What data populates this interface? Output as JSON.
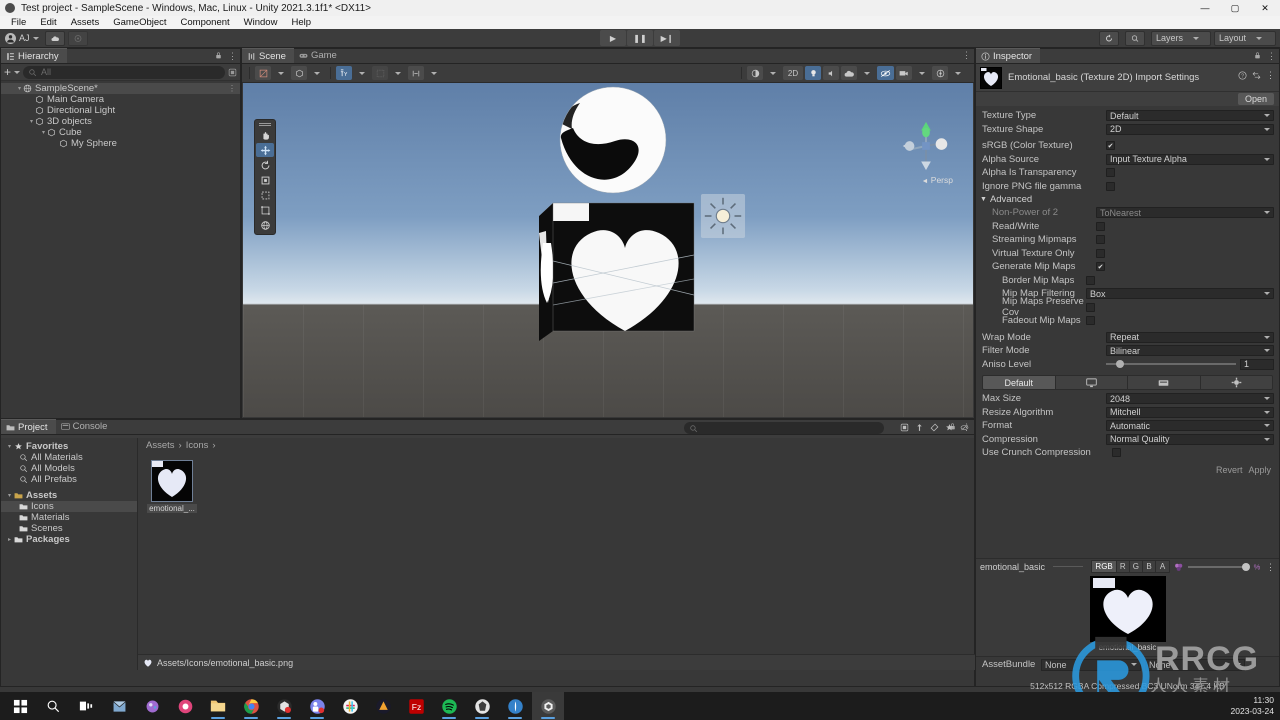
{
  "window": {
    "title": "Test project - SampleScene - Windows, Mac, Linux - Unity 2021.3.1f1* <DX11>",
    "minimize": "—",
    "maximize": "▢",
    "close": "✕"
  },
  "menubar": {
    "items": [
      "File",
      "Edit",
      "Assets",
      "GameObject",
      "Component",
      "Window",
      "Help"
    ]
  },
  "toolbar": {
    "account": "AJ",
    "cloud_icon": "cloud-icon",
    "services_icon": "services-icon",
    "play": "▶",
    "pause": "❚❚",
    "step": "▶❙",
    "undo_history_icon": "undo-history-icon",
    "search_icon": "search-icon",
    "layers": "Layers",
    "layout": "Layout"
  },
  "hierarchy": {
    "tab": "Hierarchy",
    "add_button": "+",
    "search_placeholder": "All",
    "rows": [
      {
        "label": "SampleScene*",
        "depth": 0,
        "arrow": "▾",
        "icon": "scene-icon",
        "selected": true
      },
      {
        "label": "Main Camera",
        "depth": 1,
        "arrow": "",
        "icon": "gameobject-icon",
        "selected": false
      },
      {
        "label": "Directional Light",
        "depth": 1,
        "arrow": "",
        "icon": "gameobject-icon",
        "selected": false
      },
      {
        "label": "3D objects",
        "depth": 1,
        "arrow": "▾",
        "icon": "gameobject-icon",
        "selected": false
      },
      {
        "label": "Cube",
        "depth": 2,
        "arrow": "▾",
        "icon": "gameobject-icon",
        "selected": false
      },
      {
        "label": "My Sphere",
        "depth": 3,
        "arrow": "",
        "icon": "gameobject-icon",
        "selected": false
      }
    ]
  },
  "scene": {
    "tabs": [
      {
        "label": "Scene",
        "active": true,
        "icon": "scene-view-icon"
      },
      {
        "label": "Game",
        "active": false,
        "icon": "game-view-icon"
      }
    ],
    "left_tools": [
      {
        "name": "shading-mode-dropdown",
        "glyph": "◧"
      },
      {
        "name": "draw-mode-dropdown",
        "glyph": "◈"
      },
      {
        "name": "2d-toggle-y",
        "glyph": "Y"
      },
      {
        "name": "grid-snap-dropdown",
        "glyph": "▦"
      },
      {
        "name": "component-tools",
        "glyph": "✛"
      }
    ],
    "right_tools": [
      {
        "name": "fx-toggle",
        "glyph": "◐",
        "on": false
      },
      {
        "name": "2d-button",
        "glyph": "2D",
        "on": false
      },
      {
        "name": "lighting-toggle",
        "glyph": "💡",
        "on": true
      },
      {
        "name": "audio-toggle",
        "glyph": "🔈",
        "on": false
      },
      {
        "name": "effects-toggle",
        "glyph": "☁",
        "on": false
      },
      {
        "name": "hidden-objects-toggle",
        "glyph": "👁",
        "on": true
      },
      {
        "name": "camera-settings",
        "glyph": "📷",
        "on": false
      },
      {
        "name": "gizmos-toggle",
        "glyph": "◉",
        "on": false
      }
    ],
    "gizmo_tools": [
      {
        "name": "hand-tool",
        "glyph": "✋",
        "on": false
      },
      {
        "name": "move-tool",
        "glyph": "✥",
        "on": true
      },
      {
        "name": "rotate-tool",
        "glyph": "⟳",
        "on": false
      },
      {
        "name": "scale-tool",
        "glyph": "⤢",
        "on": false
      },
      {
        "name": "rect-tool",
        "glyph": "⬚",
        "on": false
      },
      {
        "name": "transform-tool",
        "glyph": "✤",
        "on": false
      },
      {
        "name": "custom-editor-tool",
        "glyph": "⊕",
        "on": false
      }
    ],
    "persp_label": "Persp"
  },
  "project": {
    "tabs": [
      {
        "label": "Project",
        "active": true,
        "icon": "project-icon"
      },
      {
        "label": "Console",
        "active": false,
        "icon": "console-icon"
      }
    ],
    "add_button": "+",
    "search_placeholder": "",
    "tree": [
      {
        "label": "Favorites",
        "depth": 0,
        "arrow": "▾",
        "icon": "star-icon",
        "selected": false
      },
      {
        "label": "All Materials",
        "depth": 1,
        "arrow": "",
        "icon": "search-icon",
        "selected": false
      },
      {
        "label": "All Models",
        "depth": 1,
        "arrow": "",
        "icon": "search-icon",
        "selected": false
      },
      {
        "label": "All Prefabs",
        "depth": 1,
        "arrow": "",
        "icon": "search-icon",
        "selected": false
      },
      {
        "label": "Assets",
        "depth": 0,
        "arrow": "▾",
        "icon": "folder-icon",
        "selected": false
      },
      {
        "label": "Icons",
        "depth": 1,
        "arrow": "",
        "icon": "folder-icon",
        "selected": true
      },
      {
        "label": "Materials",
        "depth": 1,
        "arrow": "",
        "icon": "folder-icon",
        "selected": false
      },
      {
        "label": "Scenes",
        "depth": 1,
        "arrow": "",
        "icon": "folder-icon",
        "selected": false
      },
      {
        "label": "Packages",
        "depth": 0,
        "arrow": "▸",
        "icon": "folder-icon",
        "selected": false
      }
    ],
    "breadcrumb": [
      "Assets",
      "Icons"
    ],
    "assets": [
      {
        "label": "emotional_...",
        "icon": "heart-texture-thumbnail",
        "selected": true
      }
    ],
    "status_path": "Assets/Icons/emotional_basic.png"
  },
  "inspector": {
    "tab": "Inspector",
    "header_title": "Emotional_basic (Texture 2D) Import Settings",
    "open_label": "Open",
    "fields": [
      {
        "label": "Texture Type",
        "type": "dropdown",
        "value": "Default",
        "dim": false,
        "indent": 0
      },
      {
        "label": "Texture Shape",
        "type": "dropdown",
        "value": "2D",
        "dim": false,
        "indent": 0
      },
      {
        "label": "sRGB (Color Texture)",
        "type": "checkbox",
        "value": true,
        "dim": false,
        "indent": 0
      },
      {
        "label": "Alpha Source",
        "type": "dropdown",
        "value": "Input Texture Alpha",
        "dim": false,
        "indent": 0
      },
      {
        "label": "Alpha Is Transparency",
        "type": "checkbox",
        "value": false,
        "dim": false,
        "indent": 0
      },
      {
        "label": "Ignore PNG file gamma",
        "type": "checkbox",
        "value": false,
        "dim": false,
        "indent": 0
      }
    ],
    "advanced_label": "Advanced",
    "advanced_fields": [
      {
        "label": "Non-Power of 2",
        "type": "dropdown",
        "value": "ToNearest",
        "dim": true,
        "indent": 1
      },
      {
        "label": "Read/Write",
        "type": "checkbox",
        "value": false,
        "dim": false,
        "indent": 1
      },
      {
        "label": "Streaming Mipmaps",
        "type": "checkbox",
        "value": false,
        "dim": false,
        "indent": 1
      },
      {
        "label": "Virtual Texture Only",
        "type": "checkbox",
        "value": false,
        "dim": false,
        "indent": 1
      },
      {
        "label": "Generate Mip Maps",
        "type": "checkbox",
        "value": true,
        "dim": false,
        "indent": 1
      },
      {
        "label": "Border Mip Maps",
        "type": "checkbox",
        "value": false,
        "dim": false,
        "indent": 2
      },
      {
        "label": "Mip Map Filtering",
        "type": "dropdown",
        "value": "Box",
        "dim": false,
        "indent": 2
      },
      {
        "label": "Mip Maps Preserve Cov",
        "type": "checkbox",
        "value": false,
        "dim": false,
        "indent": 2
      },
      {
        "label": "Fadeout Mip Maps",
        "type": "checkbox",
        "value": false,
        "dim": false,
        "indent": 2
      }
    ],
    "wrap_fields": [
      {
        "label": "Wrap Mode",
        "type": "dropdown",
        "value": "Repeat",
        "dim": false,
        "indent": 0
      },
      {
        "label": "Filter Mode",
        "type": "dropdown",
        "value": "Bilinear",
        "dim": false,
        "indent": 0
      }
    ],
    "aniso": {
      "label": "Aniso Level",
      "value": "1",
      "percent": 8
    },
    "platform_tabs": [
      {
        "label": "Default",
        "icon": "",
        "active": true
      },
      {
        "label": "",
        "icon": "standalone-icon",
        "active": false
      },
      {
        "label": "",
        "icon": "webgl-icon",
        "active": false
      },
      {
        "label": "",
        "icon": "android-icon",
        "active": false
      }
    ],
    "platform_fields": [
      {
        "label": "Max Size",
        "type": "dropdown",
        "value": "2048",
        "dim": false,
        "indent": 0
      },
      {
        "label": "Resize Algorithm",
        "type": "dropdown",
        "value": "Mitchell",
        "dim": false,
        "indent": 0
      },
      {
        "label": "Format",
        "type": "dropdown",
        "value": "Automatic",
        "dim": false,
        "indent": 0
      },
      {
        "label": "Compression",
        "type": "dropdown",
        "value": "Normal Quality",
        "dim": false,
        "indent": 0
      },
      {
        "label": "Use Crunch Compression",
        "type": "checkbox",
        "value": false,
        "dim": false,
        "indent": 0
      }
    ],
    "revert_label": "Revert",
    "apply_label": "Apply",
    "preview": {
      "name": "emotional_basic",
      "channels": [
        "RGB",
        "R",
        "G",
        "B",
        "A"
      ],
      "active_channel": "RGB",
      "overlay_label": "emotional_basic",
      "info": "512x512  RGBA Compressed BC3 UNorm   341.4 KB"
    },
    "assetbundle": {
      "label": "AssetBundle",
      "value": "None",
      "value2": "None"
    }
  },
  "watermark": {
    "main": "RRCG",
    "sub": "人人素材"
  },
  "taskbar": {
    "items": [
      {
        "name": "start-button",
        "color": "#ffffff",
        "glyph": "⊞",
        "active": false,
        "running": false
      },
      {
        "name": "search-button",
        "color": "#ffffff",
        "glyph": "🔍",
        "active": false,
        "running": false
      },
      {
        "name": "task-view-button",
        "color": "#ffffff",
        "glyph": "❑",
        "active": false,
        "running": false
      },
      {
        "name": "app-mail",
        "color": "#7fa8cf",
        "glyph": "✉",
        "active": false,
        "running": false
      },
      {
        "name": "app-paint",
        "color": "#a06bd0",
        "glyph": "🎨",
        "active": false,
        "running": false
      },
      {
        "name": "app-recorder",
        "color": "#e0457b",
        "glyph": "⏺",
        "active": false,
        "running": false
      },
      {
        "name": "app-explorer",
        "color": "#f0c674",
        "glyph": "📁",
        "active": false,
        "running": true
      },
      {
        "name": "app-chrome",
        "color": "#dd5144",
        "glyph": "◉",
        "active": false,
        "running": true
      },
      {
        "name": "app-unity-hub",
        "color": "#2b2b2b",
        "glyph": "◑",
        "active": false,
        "running": true
      },
      {
        "name": "app-teams",
        "color": "#6264a7",
        "glyph": "T",
        "active": false,
        "running": true
      },
      {
        "name": "app-slack",
        "color": "#4a154b",
        "glyph": "#",
        "active": false,
        "running": false
      },
      {
        "name": "app-vpn",
        "color": "#f0a030",
        "glyph": "▲",
        "active": false,
        "running": false
      },
      {
        "name": "app-filezilla",
        "color": "#bf0000",
        "glyph": "Fz",
        "active": false,
        "running": false
      },
      {
        "name": "app-spotify",
        "color": "#1db954",
        "glyph": "♫",
        "active": false,
        "running": true
      },
      {
        "name": "app-obsidian",
        "color": "#3d3d3d",
        "glyph": "◆",
        "active": false,
        "running": true
      },
      {
        "name": "app-krita",
        "color": "#2d6ab5",
        "glyph": "✎",
        "active": false,
        "running": true
      },
      {
        "name": "app-unity",
        "color": "#4a4a4a",
        "glyph": "◈",
        "active": true,
        "running": true
      }
    ],
    "time": "11:30",
    "date": "2023-03-24"
  }
}
